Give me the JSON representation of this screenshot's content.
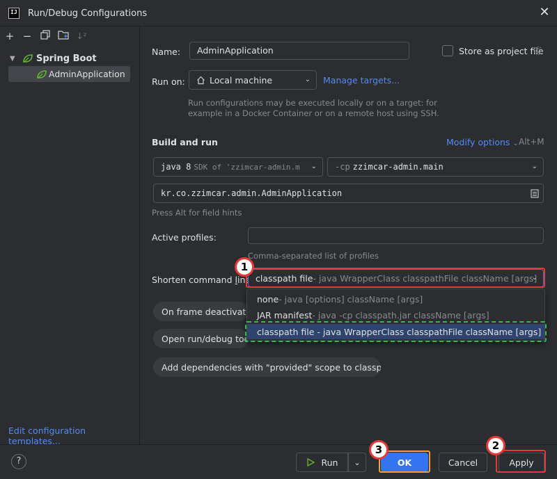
{
  "window": {
    "title": "Run/Debug Configurations"
  },
  "left": {
    "toolbar_icons": [
      "add-icon",
      "remove-icon",
      "copy-icon",
      "folder-icon",
      "sort-icon"
    ],
    "group_label": "Spring Boot",
    "item_label": "AdminApplication",
    "edit_templates": "Edit configuration templates..."
  },
  "form": {
    "name_label": "Name:",
    "name_value": "AdminApplication",
    "store_label": "Store as project file",
    "runon_label": "Run on:",
    "runon_value": "Local machine",
    "manage_targets": "Manage targets...",
    "runon_hint_1": "Run configurations may be executed locally or on a target: for",
    "runon_hint_2": "example in a Docker Container or on a remote host using SSH.",
    "build_title": "Build and run",
    "modify_options": "Modify options",
    "modify_shortcut": "Alt+M",
    "sdk_main": "java 8",
    "sdk_dim": "SDK of 'zzimcar-admin.m",
    "cp_dim": "-cp",
    "cp_main": "zzimcar-admin.main",
    "main_class": "kr.co.zzimcar.admin.AdminApplication",
    "field_hint": "Press Alt for field hints",
    "profiles_label": "Active profiles:",
    "profiles_hint": "Comma-separated list of profiles",
    "shorten_label_pre": "Shorten command ",
    "shorten_label_u": "l",
    "shorten_label_post": "ine:",
    "shorten_main": "classpath file",
    "shorten_dim": " - java WrapperClass classpathFile className [args]",
    "chip_frame": "On frame deactivation",
    "chip_open": "Open run/debug tool window when started",
    "chip_deps": "Add dependencies with \"provided\" scope to classpath"
  },
  "popup": {
    "items": [
      {
        "main": "none",
        "dim": " - java [options] className [args]"
      },
      {
        "main": "JAR manifest",
        "dim": " - java -cp classpath.jar className [args]"
      },
      {
        "main": "classpath file - java WrapperClass classpathFile className [args]",
        "dim": ""
      }
    ]
  },
  "badges": [
    "1",
    "2",
    "3"
  ],
  "footer": {
    "run": "Run",
    "ok": "OK",
    "cancel": "Cancel",
    "apply": "Apply",
    "help": "?"
  },
  "colors": {
    "accent": "#3574f0",
    "link": "#548af7",
    "annotation_red": "#e53935",
    "annotation_green": "#2ebd4e",
    "annotation_orange": "#f29d49"
  }
}
